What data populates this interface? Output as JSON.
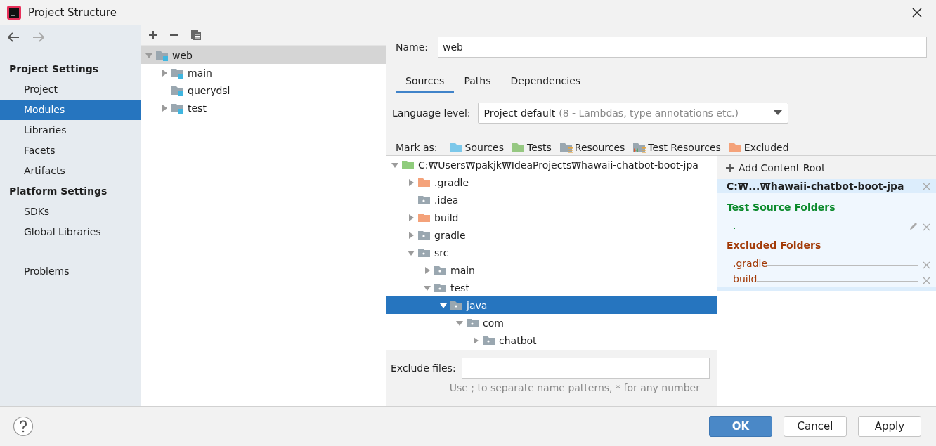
{
  "window": {
    "title": "Project Structure"
  },
  "sidebar": {
    "sections": [
      {
        "heading": "Project Settings",
        "items": [
          {
            "label": "Project",
            "selected": false
          },
          {
            "label": "Modules",
            "selected": true
          },
          {
            "label": "Libraries",
            "selected": false
          },
          {
            "label": "Facets",
            "selected": false
          },
          {
            "label": "Artifacts",
            "selected": false
          }
        ]
      },
      {
        "heading": "Platform Settings",
        "items": [
          {
            "label": "SDKs",
            "selected": false
          },
          {
            "label": "Global Libraries",
            "selected": false
          }
        ]
      }
    ],
    "extra_items": [
      {
        "label": "Problems",
        "selected": false
      }
    ]
  },
  "modules": {
    "tree": [
      {
        "label": "web",
        "selected": true,
        "expandable": true,
        "expanded": true,
        "children": [
          {
            "label": "main",
            "selected": false,
            "expandable": true,
            "expanded": false
          },
          {
            "label": "querydsl",
            "selected": false,
            "expandable": false,
            "expanded": false
          },
          {
            "label": "test",
            "selected": false,
            "expandable": true,
            "expanded": false
          }
        ]
      }
    ]
  },
  "editor": {
    "name_label": "Name:",
    "name_value": "web",
    "tabs": [
      {
        "label": "Sources",
        "selected": true
      },
      {
        "label": "Paths",
        "selected": false
      },
      {
        "label": "Dependencies",
        "selected": false
      }
    ],
    "language_level": {
      "label": "Language level:",
      "value": "Project default",
      "hint": "(8 - Lambdas, type annotations etc.)"
    },
    "mark_as": {
      "label": "Mark as:",
      "buttons": [
        {
          "kind": "sources",
          "label": "Sources"
        },
        {
          "kind": "tests",
          "label": "Tests"
        },
        {
          "kind": "resources",
          "label": "Resources"
        },
        {
          "kind": "test_resources",
          "label": "Test Resources"
        },
        {
          "kind": "excluded",
          "label": "Excluded"
        }
      ]
    },
    "folder_tree": [
      {
        "label": "C:₩Users₩pakjk₩IdeaProjects₩hawaii-chatbot-boot-jpa",
        "kind": "content_root",
        "selected": false,
        "expandable": true,
        "expanded": true,
        "children": [
          {
            "label": ".gradle",
            "kind": "excluded",
            "selected": false,
            "expandable": true,
            "expanded": false
          },
          {
            "label": ".idea",
            "kind": "plain",
            "selected": false,
            "expandable": false,
            "expanded": false
          },
          {
            "label": "build",
            "kind": "excluded",
            "selected": false,
            "expandable": true,
            "expanded": false
          },
          {
            "label": "gradle",
            "kind": "plain",
            "selected": false,
            "expandable": true,
            "expanded": false
          },
          {
            "label": "src",
            "kind": "plain",
            "selected": false,
            "expandable": true,
            "expanded": true,
            "children": [
              {
                "label": "main",
                "kind": "plain",
                "selected": false,
                "expandable": true,
                "expanded": false
              },
              {
                "label": "test",
                "kind": "plain",
                "selected": false,
                "expandable": true,
                "expanded": true,
                "children": [
                  {
                    "label": "java",
                    "kind": "plain",
                    "selected": true,
                    "expandable": true,
                    "expanded": true,
                    "children": [
                      {
                        "label": "com",
                        "kind": "plain",
                        "selected": false,
                        "expandable": true,
                        "expanded": true,
                        "children": [
                          {
                            "label": "chatbot",
                            "kind": "plain",
                            "selected": false,
                            "expandable": true,
                            "expanded": false
                          }
                        ]
                      }
                    ]
                  }
                ]
              }
            ]
          }
        ]
      }
    ],
    "content_roots": {
      "add_label": "Add Content Root",
      "root": "C:₩...₩hawaii-chatbot-boot-jpa",
      "sections": [
        {
          "kind": "test_source",
          "title": "Test Source Folders",
          "folders": [
            "."
          ]
        },
        {
          "kind": "excluded",
          "title": "Excluded Folders",
          "folders": [
            ".gradle",
            "build"
          ]
        }
      ]
    },
    "exclude_files": {
      "label": "Exclude files:",
      "hint": "Use ; to separate name patterns, * for any number"
    }
  },
  "buttons": [
    {
      "label": "OK",
      "default": true
    },
    {
      "label": "Cancel",
      "default": false
    },
    {
      "label": "Apply",
      "default": false
    }
  ]
}
